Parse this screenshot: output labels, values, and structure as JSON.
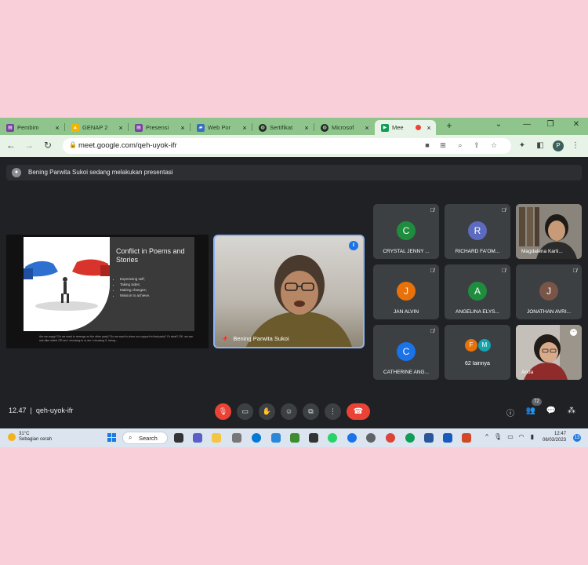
{
  "browser": {
    "tabs": [
      {
        "label": "Pembim",
        "fav": "#7b3fa3",
        "icon": "doc-icon"
      },
      {
        "label": "GENAP 2",
        "fav": "#f4b400",
        "icon": "drive-icon"
      },
      {
        "label": "Presensi",
        "fav": "#7b3fa3",
        "icon": "form-icon"
      },
      {
        "label": "Web Por",
        "fav": "#3a6ec1",
        "icon": "web-icon"
      },
      {
        "label": "Sertifikat",
        "fav": "#1d2b1d",
        "icon": "globe-icon"
      },
      {
        "label": "Microsof",
        "fav": "#1d2b1d",
        "icon": "globe-icon"
      },
      {
        "label": "Mee",
        "fav": "#0f9d58",
        "icon": "meet-icon"
      }
    ],
    "url": "meet.google.com/qeh-uyok-ifr"
  },
  "meet": {
    "banner": "Bening Parwita Sukoi sedang melakukan presentasi",
    "slide": {
      "title": "Conflict in Poems and Stories",
      "bullets": [
        "Expressing self;",
        "Taking sides;",
        "Making changes;",
        "Mission to achieve."
      ],
      "footer": "Are we angry? Do we want to revenge on the other party? Do we want to show our support to that party? Or what? OK, we can use take sides! OR am I choosing to or am I choosing X, being..."
    },
    "presenter": {
      "name": "Bening Parwita Sukoi"
    },
    "participants": [
      {
        "name": "CRYSTAL JENNY ...",
        "initial": "C",
        "color": "#1e8e3e"
      },
      {
        "name": "RICHARD FA'OM...",
        "initial": "R",
        "color": "#5c6bc0"
      },
      {
        "name": "Magdalena Karti...",
        "photo": true
      },
      {
        "name": "JAN ALVIN",
        "initial": "J",
        "color": "#e8710a"
      },
      {
        "name": "ANGELINA ELYS...",
        "initial": "A",
        "color": "#1e8e3e"
      },
      {
        "name": "JONATHAN AVRI...",
        "initial": "J",
        "color": "#795548"
      },
      {
        "name": "CATHERINE ANG...",
        "initial": "C",
        "color": "#1a73e8"
      },
      {
        "name": "62 lainnya",
        "initials": [
          "F",
          "M"
        ]
      },
      {
        "name": "Anda",
        "photo": true
      }
    ],
    "time": "12.47",
    "meeting_code": "qeh-uyok-ifr",
    "participant_count": "72"
  },
  "taskbar": {
    "weather_temp": "31°C",
    "weather_desc": "Sebagian cerah",
    "search_label": "Search",
    "clock_time": "12:47",
    "clock_date": "06/03/2023",
    "notification_count": "13"
  }
}
